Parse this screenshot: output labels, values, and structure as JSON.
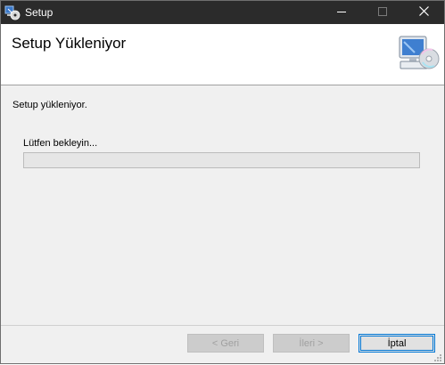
{
  "window": {
    "title": "Setup",
    "controls": {
      "minimize": "minimize-icon",
      "maximize": "maximize-icon",
      "close": "close-icon"
    }
  },
  "banner": {
    "title": "Setup Yükleniyor",
    "icon": "computer-cd-icon"
  },
  "body": {
    "status_text": "Setup yükleniyor.",
    "wait_label": "Lütfen bekleyin...",
    "progress_percent": 0
  },
  "buttons": {
    "back": "< Geri",
    "next": "İleri >",
    "cancel": "İptal"
  },
  "colors": {
    "titlebar": "#2b2b2b",
    "window_bg": "#f0f0f0",
    "banner_bg": "#ffffff",
    "accent": "#0078d7"
  }
}
